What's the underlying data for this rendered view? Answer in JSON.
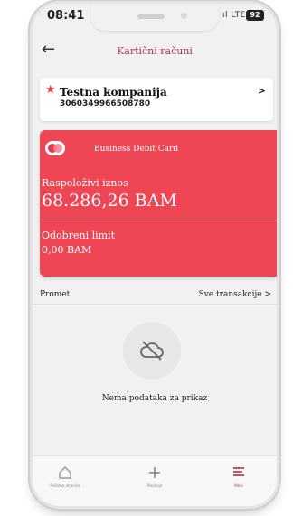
{
  "status_bar": {
    "time": "08:41",
    "network": "LTE",
    "battery": "92"
  },
  "header": {
    "title": "Kartični računi"
  },
  "company": {
    "name": "Testna kompanija",
    "number": "3060349966508780"
  },
  "card": {
    "type_label": "Business Debit Card",
    "available_label": "Raspoloživi iznos",
    "available_amount": "68.286,26 BAM",
    "limit_label": "Odobreni limit",
    "limit_amount": "0,00 BAM",
    "color": "#ee4655"
  },
  "transactions": {
    "title": "Promet",
    "all_link": "Sve transakcije >"
  },
  "empty_state": {
    "icon": "cloud-off-icon",
    "message": "Nema podataka za prikaz"
  },
  "tab_bar": {
    "items": [
      {
        "label": "Početna stranica",
        "icon": "home-icon"
      },
      {
        "label": "Plaćanja",
        "icon": "plus-icon"
      },
      {
        "label": "Meni",
        "icon": "menu-icon",
        "active": true
      }
    ]
  }
}
